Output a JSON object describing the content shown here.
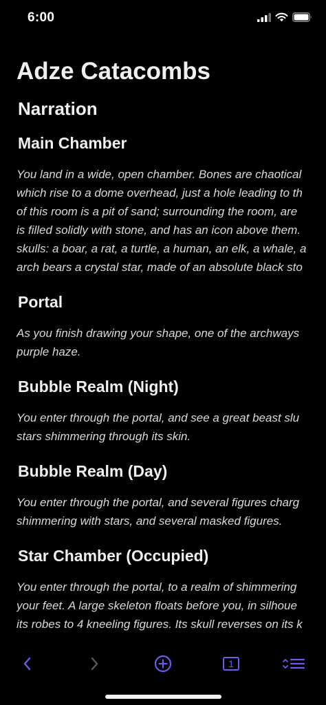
{
  "status_bar": {
    "time": "6:00",
    "icons": [
      "cellular-signal-icon",
      "wifi-icon",
      "battery-icon"
    ]
  },
  "document": {
    "title": "Adze Catacombs",
    "section": "Narration",
    "entries": [
      {
        "heading": "Main Chamber",
        "lines": [
          "You land in a wide, open chamber. Bones are chaotical",
          "which rise to a dome overhead, just a hole leading to th",
          "of this room is a pit of sand; surrounding the room, are",
          "is filled solidly with stone, and has an icon above them.",
          "skulls: a boar, a rat, a turtle, a human, an elk, a whale, a",
          "arch bears a crystal star, made of an absolute black sto"
        ]
      },
      {
        "heading": "Portal",
        "lines": [
          "As you finish drawing your shape, one of the archways",
          "purple haze."
        ]
      },
      {
        "heading": "Bubble Realm (Night)",
        "lines": [
          "You enter through the portal, and see a great beast slu",
          "stars shimmering through its skin."
        ]
      },
      {
        "heading": "Bubble Realm (Day)",
        "lines": [
          "You enter through the portal, and several figures charg",
          "shimmering with stars, and several masked figures."
        ]
      },
      {
        "heading": "Star Chamber (Occupied)",
        "lines": [
          "You enter through the portal, to a realm of shimmering",
          "your feet. A large skeleton floats before you, in silhoue",
          "its robes to 4 kneeling figures. Its skull reverses on its k"
        ]
      }
    ]
  },
  "toolbar": {
    "back_icon": "chevron-left-icon",
    "forward_icon": "chevron-right-icon",
    "add_icon": "plus-circle-icon",
    "tab_count": "1",
    "menu_icon": "sort-list-icon"
  },
  "colors": {
    "background": "#000000",
    "text": "#ececec",
    "accent": "#6b5bf0",
    "disabled": "#5a5a5e"
  }
}
